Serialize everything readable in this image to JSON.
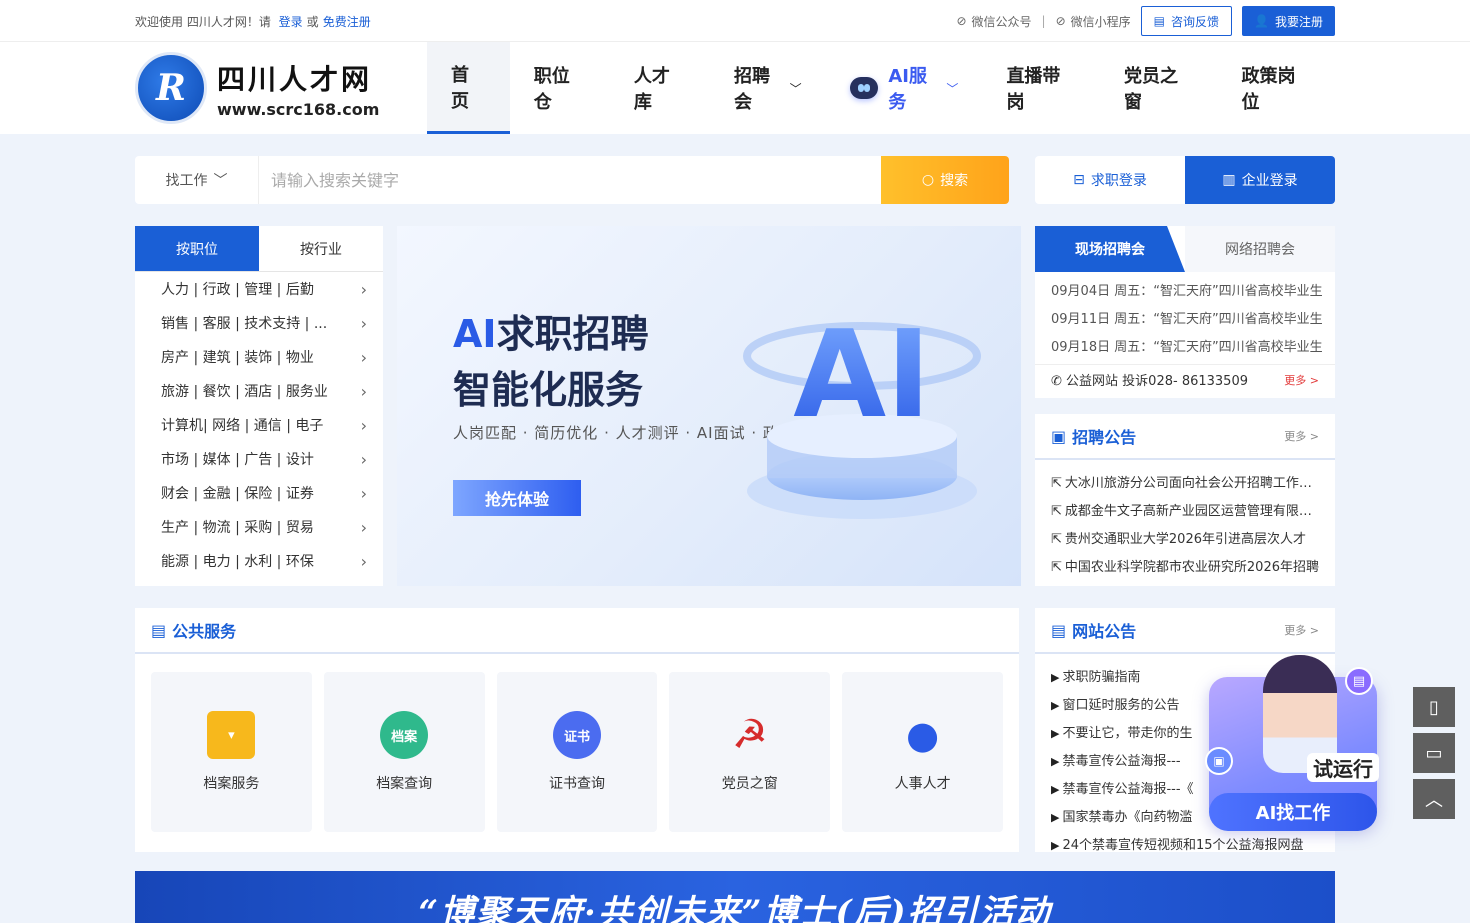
{
  "topbar": {
    "welcome": "欢迎使用 四川人才网！请",
    "login": "登录",
    "or": "或",
    "register_free": "免费注册",
    "wechat_official": "微信公众号",
    "divider": "|",
    "wechat_mini": "微信小程序",
    "feedback": "咨询反馈",
    "register": "我要注册"
  },
  "logo": {
    "cn": "四川人才网",
    "url": "www.scrc168.com"
  },
  "nav": [
    {
      "label": "首页",
      "active": true
    },
    {
      "label": "职位仓"
    },
    {
      "label": "人才库"
    },
    {
      "label": "招聘会",
      "dropdown": true
    },
    {
      "label": "AI服务",
      "dropdown": true,
      "ai": true
    },
    {
      "label": "直播带岗"
    },
    {
      "label": "党员之窗"
    },
    {
      "label": "政策岗位"
    }
  ],
  "search": {
    "type": "找工作",
    "placeholder": "请输入搜索关键字",
    "button": "搜索",
    "seeker_login": "求职登录",
    "corp_login": "企业登录"
  },
  "categories": {
    "tabs": [
      "按职位",
      "按行业"
    ],
    "items": [
      "人力 | 行政 | 管理 | 后勤",
      "销售 | 客服 | 技术支持 | ...",
      "房产 | 建筑 | 装饰 | 物业",
      "旅游 | 餐饮 | 酒店 | 服务业",
      "计算机| 网络 | 通信 | 电子",
      "市场 | 媒体 | 广告 | 设计",
      "财会 | 金融 | 保险 | 证券",
      "生产 | 物流 | 采购 | 贸易",
      "能源 | 电力 | 水利 | 环保"
    ]
  },
  "banner": {
    "title_ai": "AI",
    "title_line1": "求职招聘",
    "title_line2": "智能化服务",
    "subtitle": "人岗匹配 · 简历优化 · 人才测评 · AI面试 · 政策问答",
    "button": "抢先体验",
    "graphic": "AI"
  },
  "fair": {
    "tabs": [
      "现场招聘会",
      "网络招聘会"
    ],
    "items": [
      "09月04日 周五：“智汇天府”四川省高校毕业生",
      "09月11日 周五：“智汇天府”四川省高校毕业生",
      "09月18日 周五：“智汇天府”四川省高校毕业生"
    ],
    "hotline": "公益网站 投诉028- 86133509",
    "more": "更多 >"
  },
  "recruit_notice": {
    "title": "招聘公告",
    "more": "更多 >",
    "items": [
      "大冰川旅游分公司面向社会公开招聘工作人员",
      "成都金牛文子高新产业园区运营管理有限公司",
      "贵州交通职业大学2026年引进高层次人才",
      "中国农业科学院都市农业研究所2026年招聘"
    ]
  },
  "site_notice": {
    "title": "网站公告",
    "more": "更多 >",
    "items": [
      "求职防骗指南",
      "窗口延时服务的公告",
      "不要让它，带走你的生",
      "禁毒宣传公益海报---",
      "禁毒宣传公益海报---《",
      "国家禁毒办《向药物滥",
      "24个禁毒宣传短视频和15个公益海报网盘"
    ]
  },
  "services": {
    "title": "公共服务",
    "items": [
      {
        "label": "档案服务",
        "icon": "folder-icon",
        "badge": ""
      },
      {
        "label": "档案查询",
        "icon": "archive-search-icon",
        "badge": "档案"
      },
      {
        "label": "证书查询",
        "icon": "certificate-search-icon",
        "badge": "证书"
      },
      {
        "label": "党员之窗",
        "icon": "party-emblem-icon",
        "badge": "☭"
      },
      {
        "label": "人事人才",
        "icon": "person-icon",
        "badge": ""
      }
    ]
  },
  "bottom_banner": {
    "text": "“博聚天府·共创未来”博士(后)招引活动"
  },
  "ai_widget": {
    "running": "试运行",
    "button": "AI找工作"
  },
  "colors": {
    "primary": "#1a5fd6",
    "search_button": "#ffa31a",
    "more": "#e23b3b"
  }
}
